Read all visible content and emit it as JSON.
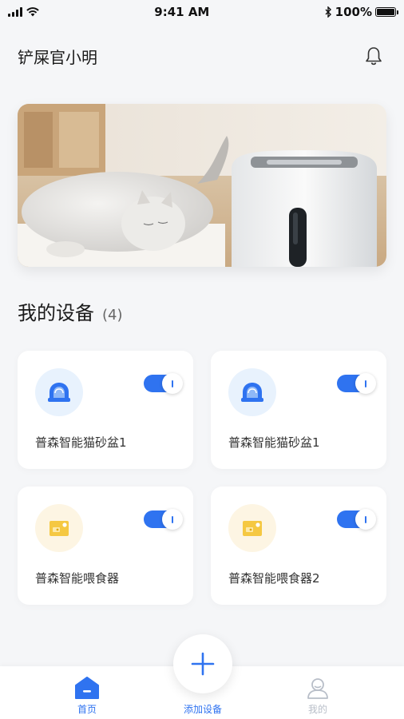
{
  "status_bar": {
    "time": "9:41 AM",
    "battery": "100%"
  },
  "header": {
    "title": "铲屎官小明"
  },
  "section": {
    "title": "我的设备",
    "count": "(4)"
  },
  "devices": [
    {
      "name": "普森智能猫砂盆1",
      "icon": "litter-box-icon",
      "enabled": true
    },
    {
      "name": "普森智能猫砂盆1",
      "icon": "litter-box-icon",
      "enabled": true
    },
    {
      "name": "普森智能喂食器",
      "icon": "feeder-icon",
      "enabled": true
    },
    {
      "name": "普森智能喂食器2",
      "icon": "feeder-icon",
      "enabled": true
    }
  ],
  "nav": {
    "home": "首页",
    "add": "添加设备",
    "mine": "我的"
  },
  "colors": {
    "accent": "#2f73f0",
    "active_nav": "#2f73f0",
    "inactive_nav": "#b8bec8",
    "feeder_icon": "#f5c842"
  }
}
